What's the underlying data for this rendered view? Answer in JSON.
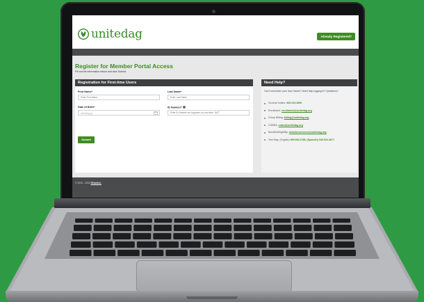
{
  "site": {
    "logo_text": "unitedag",
    "already_registered": "Already Registered?"
  },
  "page": {
    "title": "Register for Member Portal Access",
    "subtitle": "Fill out the information below and click Submit."
  },
  "registration": {
    "heading": "Registration for First-time Users",
    "first_name_label": "First Name*",
    "first_name_placeholder": "Enter First Name",
    "last_name_label": "Last Name*",
    "last_name_placeholder": "Enter Last Name",
    "dob_label": "Date of Birth*",
    "dob_placeholder": "mm/dd/yyyy",
    "id_label": "ID Number*",
    "id_placeholder": "Enter ID Number as it appears on card after \"UAT\"",
    "submit_label": "Submit"
  },
  "help": {
    "heading": "Need Help?",
    "intro": "Can't remember your User Name? Need help logging in? Questions?",
    "items": [
      {
        "label": "General hotline:",
        "value": "800.223.4590",
        "link": false
      },
      {
        "label": "Enrollment:",
        "value": "enrollment@unitedag.org",
        "link": true
      },
      {
        "label": "Group Billing:",
        "value": "billing@unitedag.org",
        "link": true
      },
      {
        "label": "COBRA:",
        "value": "cobra@unitedag.org",
        "link": true
      },
      {
        "label": "Benefits/Eligibility:",
        "value": "memberservices@unitedag.org",
        "link": true
      },
      {
        "label": "Text Msg: (English)",
        "value": "949.594.0788, (Spanish) 949.524.4677",
        "link": false
      }
    ]
  },
  "footer": {
    "copyright": "© 2015 - 2024",
    "company": "HCactive."
  },
  "colors": {
    "background": "#2f9a44",
    "brand_green": "#3f8c23",
    "dark_bar": "#4a4b4d"
  }
}
